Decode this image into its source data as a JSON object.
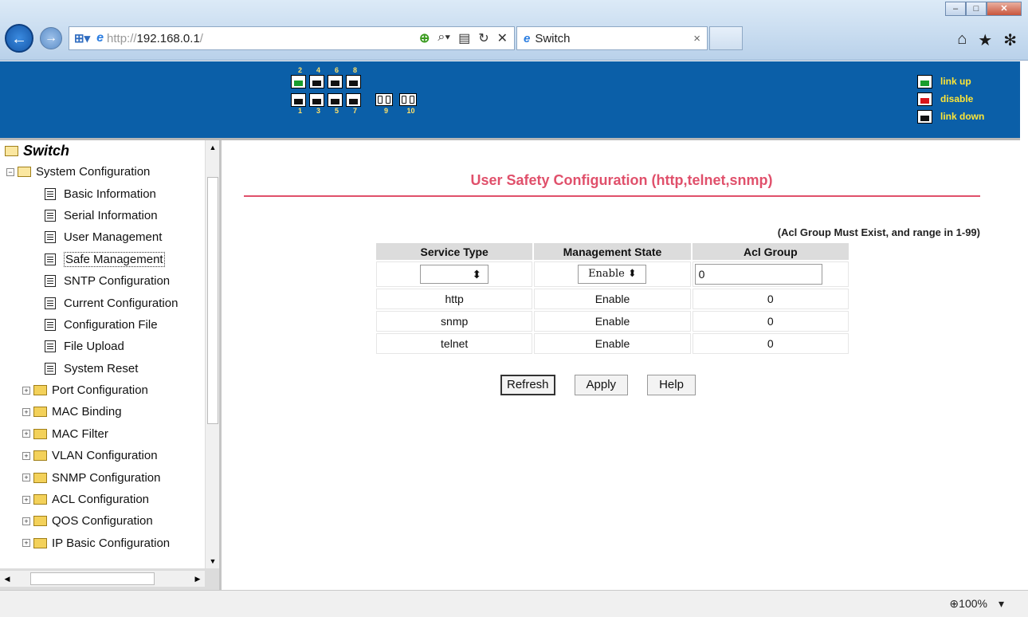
{
  "browser": {
    "address_prefix": "http://",
    "address_host": "192.168.0.1",
    "address_suffix": "/",
    "tab_title": "Switch",
    "zoom": "100%"
  },
  "ports": {
    "top_numbers": [
      "2",
      "4",
      "6",
      "8"
    ],
    "bottom_numbers": [
      "1",
      "3",
      "5",
      "7",
      "9",
      "10"
    ],
    "top_states": [
      "up",
      "down",
      "down",
      "down"
    ],
    "bottom_states": [
      "down",
      "down",
      "down",
      "down"
    ]
  },
  "legend": {
    "up": "link up",
    "disable": "disable",
    "down": "link down"
  },
  "tree": {
    "root": "Switch",
    "system": "System Configuration",
    "system_items": [
      "Basic Information",
      "Serial Information",
      "User Management",
      "Safe Management",
      "SNTP Configuration",
      "Current Configuration",
      "Configuration File",
      "File Upload",
      "System Reset"
    ],
    "folders": [
      "Port Configuration",
      "MAC Binding",
      "MAC Filter",
      "VLAN Configuration",
      "SNMP Configuration",
      "ACL Configuration",
      "QOS Configuration",
      "IP Basic Configuration"
    ]
  },
  "page": {
    "title": "User Safety Configuration (http,telnet,snmp)",
    "note": "(Acl Group Must Exist, and range in 1-99)"
  },
  "table": {
    "headers": [
      "Service Type",
      "Management State",
      "Acl Group"
    ],
    "input": {
      "service": "",
      "state": "Enable",
      "acl": "0"
    },
    "rows": [
      [
        "http",
        "Enable",
        "0"
      ],
      [
        "snmp",
        "Enable",
        "0"
      ],
      [
        "telnet",
        "Enable",
        "0"
      ]
    ]
  },
  "buttons": {
    "refresh": "Refresh",
    "apply": "Apply",
    "help": "Help"
  }
}
